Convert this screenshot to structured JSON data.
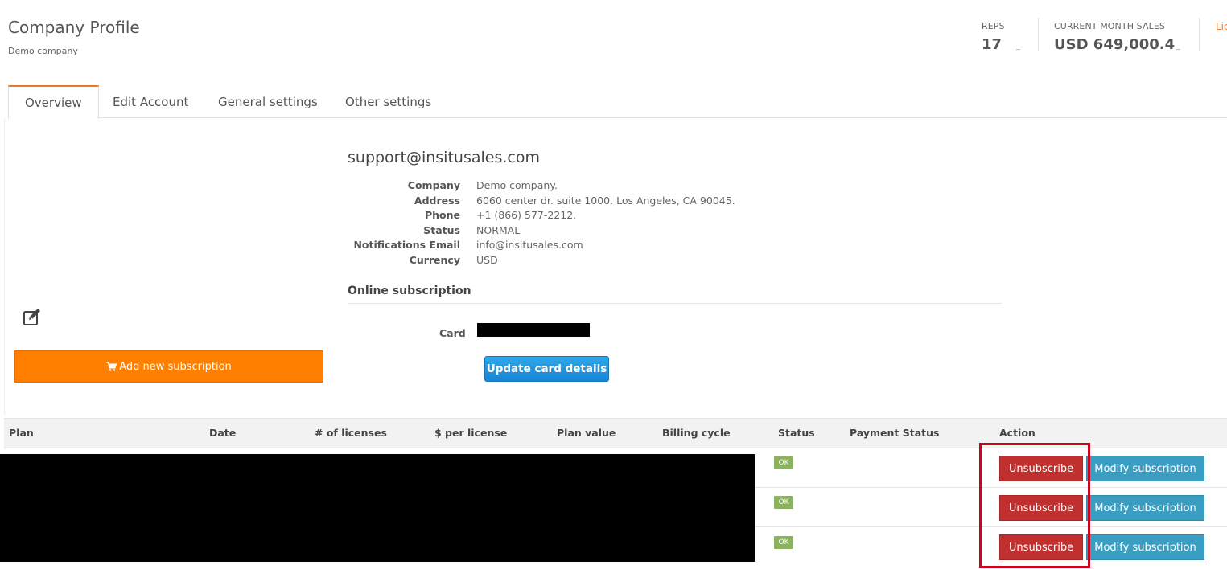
{
  "header": {
    "title": "Company Profile",
    "subtitle": "Demo company"
  },
  "stats": {
    "reps_label": "REPS",
    "reps_value": "17",
    "sales_label": "CURRENT MONTH SALES",
    "sales_value": "USD 649,000.4",
    "dash": "_",
    "licenses_label": "Lic"
  },
  "tabs": [
    {
      "label": "Overview",
      "active": true
    },
    {
      "label": "Edit Account",
      "active": false
    },
    {
      "label": "General settings",
      "active": false
    },
    {
      "label": "Other settings",
      "active": false
    }
  ],
  "left_panel": {
    "edit_icon": "edit-icon",
    "add_subscription_label": "Add new subscription",
    "add_subscription_color": "#ff7f00"
  },
  "profile": {
    "email": "support@insitusales.com",
    "details": [
      {
        "key": "Company",
        "value": "Demo company."
      },
      {
        "key": "Address",
        "value": "6060 center dr. suite 1000. Los Angeles, CA 90045."
      },
      {
        "key": "Phone",
        "value": "+1 (866) 577-2212."
      },
      {
        "key": "Status",
        "value": "NORMAL"
      },
      {
        "key": "Notifications Email",
        "value": "info@insitusales.com"
      },
      {
        "key": "Currency",
        "value": "USD"
      }
    ]
  },
  "online_subscription": {
    "heading": "Online subscription",
    "card_label": "Card",
    "update_button": "Update card details"
  },
  "table": {
    "headers": [
      "Plan",
      "Date",
      "# of licenses",
      "$ per license",
      "Plan value",
      "Billing cycle",
      "Status",
      "Payment Status",
      "Action"
    ],
    "rows": [
      {
        "status": "OK",
        "unsubscribe": "Unsubscribe",
        "modify": "Modify subscription"
      },
      {
        "status": "OK",
        "unsubscribe": "Unsubscribe",
        "modify": "Modify subscription"
      },
      {
        "status": "OK",
        "unsubscribe": "Unsubscribe",
        "modify": "Modify subscription"
      }
    ]
  },
  "colors": {
    "accent_orange": "#e87a2e",
    "unsubscribe_red": "#c0302f",
    "modify_blue": "#3a9ec2",
    "ok_green": "#8bb35e",
    "highlight_red": "#d0021b"
  }
}
